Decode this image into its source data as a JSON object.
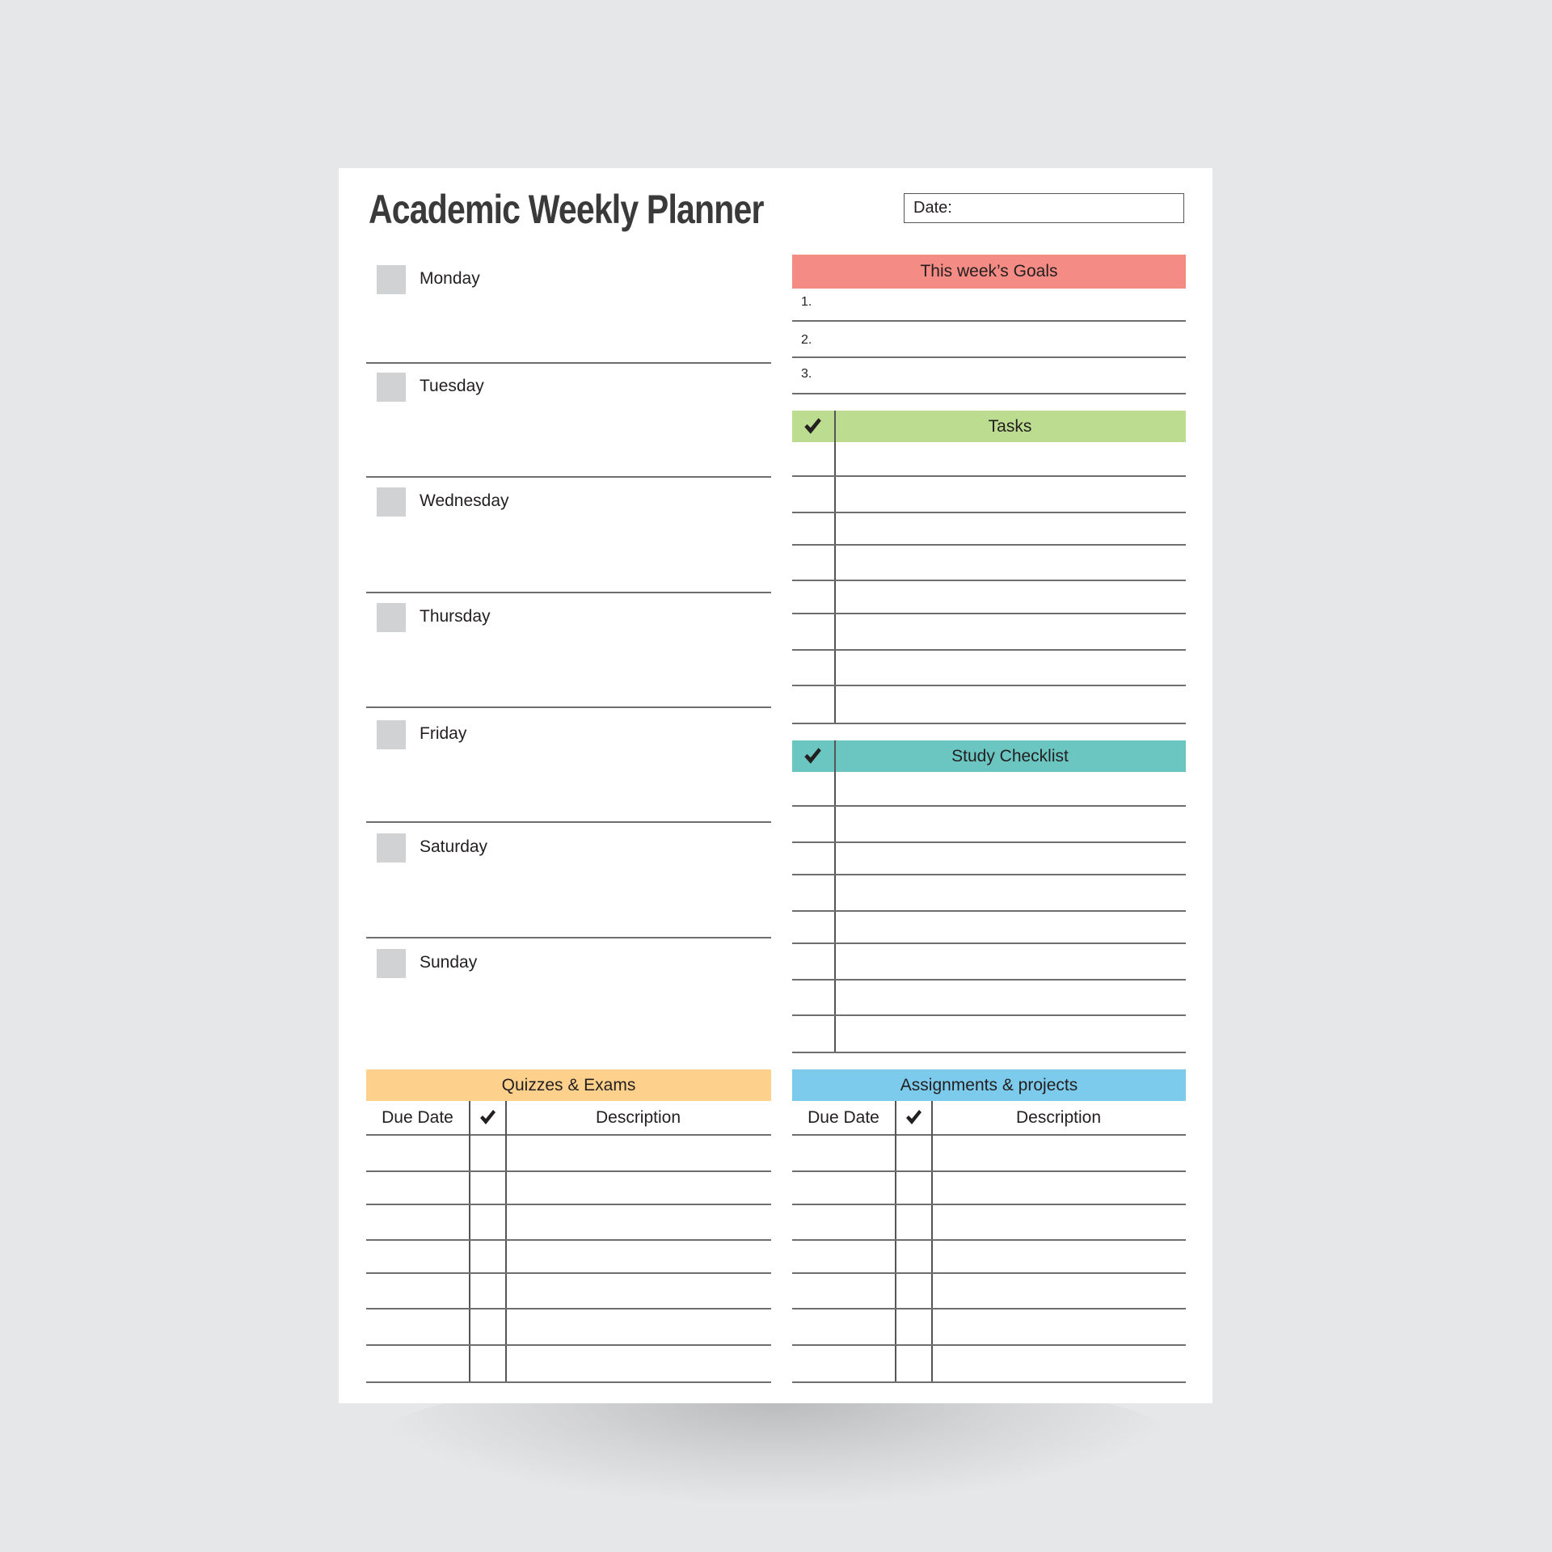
{
  "title": "Academic Weekly Planner",
  "date_label": "Date:",
  "date_value": "",
  "days": [
    {
      "label": "Monday",
      "notes": ""
    },
    {
      "label": "Tuesday",
      "notes": ""
    },
    {
      "label": "Wednesday",
      "notes": ""
    },
    {
      "label": "Thursday",
      "notes": ""
    },
    {
      "label": "Friday",
      "notes": ""
    },
    {
      "label": "Saturday",
      "notes": ""
    },
    {
      "label": "Sunday",
      "notes": ""
    }
  ],
  "goals": {
    "header": "This week’s Goals",
    "color": "#f48b84",
    "items": [
      {
        "number": "1.",
        "text": ""
      },
      {
        "number": "2.",
        "text": ""
      },
      {
        "number": "3.",
        "text": ""
      }
    ]
  },
  "tasks": {
    "header": "Tasks",
    "check_icon": "checkmark-icon",
    "color": "#bcdc8f",
    "rows": [
      "",
      "",
      "",
      "",
      "",
      "",
      "",
      ""
    ]
  },
  "study_checklist": {
    "header": "Study Checklist",
    "check_icon": "checkmark-icon",
    "color": "#6bc6c2",
    "rows": [
      "",
      "",
      "",
      "",
      "",
      "",
      "",
      ""
    ]
  },
  "quizzes": {
    "header": "Quizzes & Exams",
    "color": "#fdd08c",
    "columns": [
      "Due Date",
      "✔",
      "Description"
    ],
    "rows": [
      {
        "due_date": "",
        "done": false,
        "description": ""
      },
      {
        "due_date": "",
        "done": false,
        "description": ""
      },
      {
        "due_date": "",
        "done": false,
        "description": ""
      },
      {
        "due_date": "",
        "done": false,
        "description": ""
      },
      {
        "due_date": "",
        "done": false,
        "description": ""
      },
      {
        "due_date": "",
        "done": false,
        "description": ""
      },
      {
        "due_date": "",
        "done": false,
        "description": ""
      }
    ]
  },
  "assignments": {
    "header": "Assignments & projects",
    "color": "#7ccbec",
    "columns": [
      "Due Date",
      "✔",
      "Description"
    ],
    "rows": [
      {
        "due_date": "",
        "done": false,
        "description": ""
      },
      {
        "due_date": "",
        "done": false,
        "description": ""
      },
      {
        "due_date": "",
        "done": false,
        "description": ""
      },
      {
        "due_date": "",
        "done": false,
        "description": ""
      },
      {
        "due_date": "",
        "done": false,
        "description": ""
      },
      {
        "due_date": "",
        "done": false,
        "description": ""
      },
      {
        "due_date": "",
        "done": false,
        "description": ""
      }
    ]
  },
  "colors": {
    "background": "#e6e7e9",
    "paper": "#ffffff",
    "day_checkbox": "#d1d2d4",
    "text": "#231f20"
  }
}
